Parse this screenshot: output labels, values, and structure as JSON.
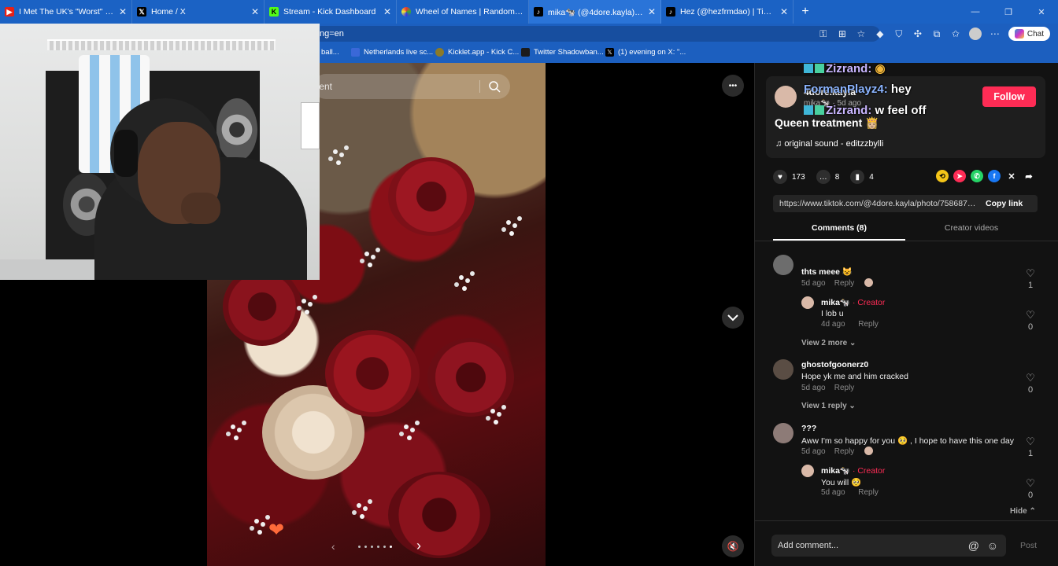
{
  "browser": {
    "tabs": [
      {
        "title": "I Met The UK's \"Worst\" Pro Boxer..",
        "icon_color": "#e62117",
        "icon": "youtube-icon"
      },
      {
        "title": "Home / X",
        "icon_color": "#000000",
        "icon": "x-icon"
      },
      {
        "title": "Stream - Kick Dashboard",
        "icon_color": "#53fc18",
        "icon": "kick-icon"
      },
      {
        "title": "Wheel of Names | Random name p",
        "icon_color": "#e3a21a",
        "icon": "wheel-icon"
      },
      {
        "title": "mika🐄 (@4dore.kayla) | TikTok",
        "icon_color": "#000000",
        "icon": "tiktok-icon"
      },
      {
        "title": "Hez (@hezfrmdao) | TikTok",
        "icon_color": "#000000",
        "icon": "tiktok-icon"
      }
    ],
    "tab_close": "✕",
    "new_tab": "+",
    "url_visible": "ng=en",
    "chat_label": "Chat",
    "bookmarks": [
      {
        "label": "ball...",
        "color": "#2d2d2d"
      },
      {
        "label": "Netherlands live sc...",
        "color": "#3a68d8"
      },
      {
        "label": "Kicklet.app - Kick C...",
        "color": "#5a7a2a"
      },
      {
        "label": "Twitter Shadowban...",
        "color": "#1c1c1c"
      },
      {
        "label": "(1) evening on X: \"...",
        "color": "#000000"
      }
    ]
  },
  "video": {
    "search_placeholder": "tent",
    "more": "•••",
    "heart": "❤"
  },
  "stream_overlay": {
    "messages": [
      {
        "user": "Zizrand:",
        "text": "",
        "color": "#c9b6ff"
      },
      {
        "user": "FormanPlayz4:",
        "text": "hey",
        "color": "#8bb4ff"
      },
      {
        "user": "Zizrand:",
        "text": "w feel off",
        "color": "#c9b6ff"
      }
    ]
  },
  "post": {
    "username": "4dore.kayla",
    "display": "mika🐄",
    "age": "5d ago",
    "follow_label": "Follow",
    "caption": "Queen treatment 👸🏼",
    "sound": "original sound - editzzbylli",
    "likes": "173",
    "comments": "8",
    "saves": "4",
    "link": "https://www.tiktok.com/@4dore.kayla/photo/75868773...",
    "copy_label": "Copy link",
    "tab_comments": "Comments (8)",
    "tab_creator": "Creator videos"
  },
  "comments": [
    {
      "name": "thts meee 😺",
      "text": "",
      "age": "5d ago",
      "reply": "Reply",
      "likes": "1"
    },
    {
      "name": "mika🐄",
      "creator": "· Creator",
      "text": "I lob u",
      "age": "4d ago",
      "reply": "Reply",
      "likes": "0"
    },
    {
      "view_more": "View 2 more"
    },
    {
      "name": "ghostofgoonerz0",
      "text": "Hope yk me and him cracked",
      "age": "5d ago",
      "reply": "Reply",
      "likes": "0"
    },
    {
      "view_more": "View 1 reply"
    },
    {
      "name": "???",
      "text": "Aww I'm so happy for you 🥺 , I hope to have this one day",
      "age": "5d ago",
      "reply": "Reply",
      "likes": "1"
    },
    {
      "name": "mika🐄",
      "creator": "· Creator",
      "text": "You will 🥺",
      "age": "5d ago",
      "reply": "Reply",
      "likes": "0"
    }
  ],
  "hide_label": "Hide",
  "add_comment": {
    "placeholder": "Add comment...",
    "post_label": "Post"
  },
  "colors": {
    "accent": "#fe2c55",
    "tab_bar": "#1b62c4",
    "panel": "#121212"
  }
}
